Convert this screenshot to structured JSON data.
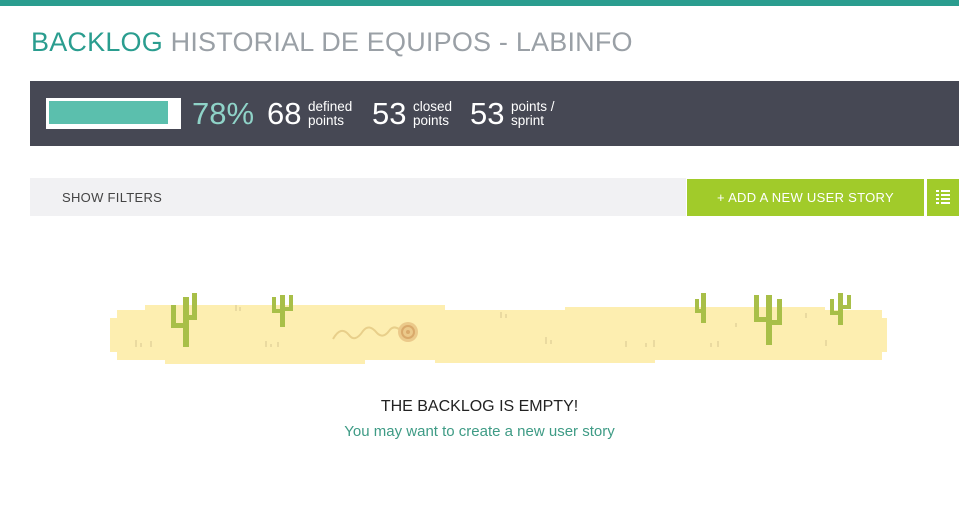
{
  "header": {
    "title_lead": "BACKLOG",
    "title_rest": "HISTORIAL DE EQUIPOS - LABINFO"
  },
  "summary": {
    "progress_fraction": 0.78,
    "percent_label": "78%",
    "defined_points": "68",
    "defined_label_1": "defined",
    "defined_label_2": "points",
    "closed_points": "53",
    "closed_label_1": "closed",
    "closed_label_2": "points",
    "sprint_points": "53",
    "sprint_label_1": "points /",
    "sprint_label_2": "sprint"
  },
  "toolbar": {
    "filters_label": "SHOW FILTERS",
    "add_story_label": "+ ADD A NEW USER STORY",
    "list_icon": "list-icon"
  },
  "empty_state": {
    "title": "THE BACKLOG IS EMPTY!",
    "subtitle": "You may want to create a new user story"
  },
  "colors": {
    "accent": "#2a9d8f",
    "summary_bg": "#464854",
    "progress_fill": "#5bbfad",
    "button_green": "#a1cb2a",
    "sand": "#fdeeb0",
    "cactus": "#a8bf48"
  }
}
